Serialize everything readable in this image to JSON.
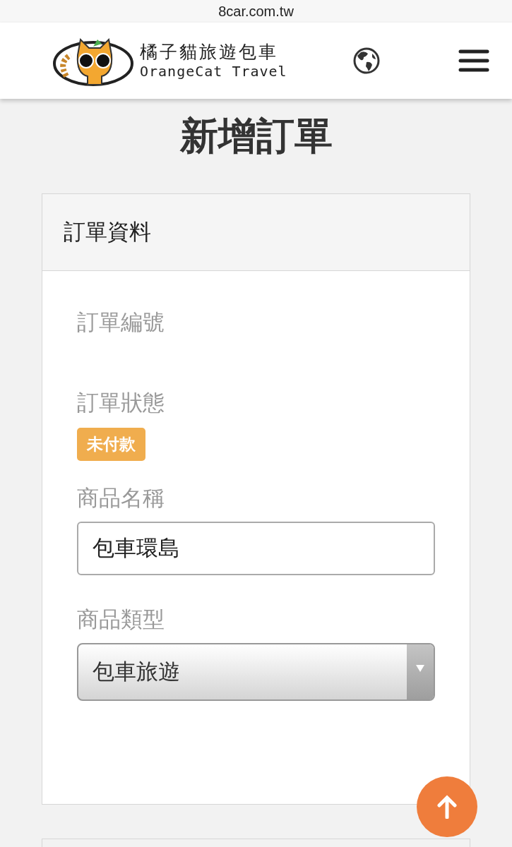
{
  "browser": {
    "url": "8car.com.tw"
  },
  "header": {
    "brand_name": "橘子貓旅遊包車",
    "brand_subtitle": "OrangeCat Travel"
  },
  "page_title": "新增訂單",
  "card": {
    "title": "訂單資料",
    "fields": [
      {
        "kind": "text",
        "label": "訂單編號"
      },
      {
        "kind": "badge",
        "label": "訂單狀態",
        "badge": "未付款",
        "color": "#f0ad4e"
      },
      {
        "kind": "input",
        "label": "商品名稱",
        "value": "包車環島"
      },
      {
        "kind": "select",
        "label": "商品類型",
        "value": "包車旅遊"
      }
    ]
  }
}
